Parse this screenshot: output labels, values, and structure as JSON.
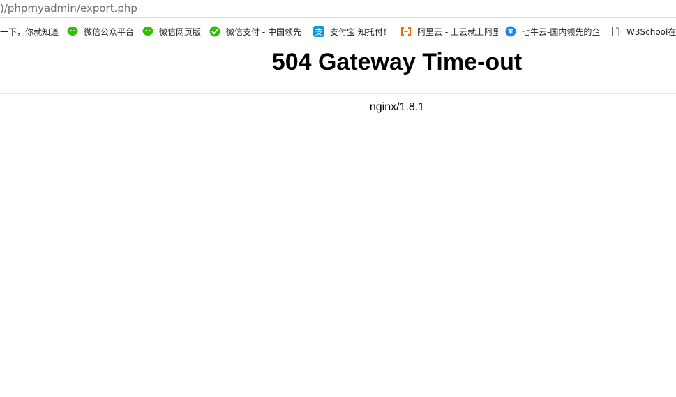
{
  "address_bar": {
    "url": ")/phpmyadmin/export.php"
  },
  "bookmarks": [
    {
      "label": "一下，你就知道",
      "icon": "none"
    },
    {
      "label": "微信公众平台",
      "icon": "wechat-icon"
    },
    {
      "label": "微信网页版",
      "icon": "wechat-icon"
    },
    {
      "label": "微信支付 - 中国领先",
      "icon": "wechat-pay-icon"
    },
    {
      "label": "支付宝 知托付！",
      "icon": "alipay-icon"
    },
    {
      "label": "阿里云 - 上云就上阿里",
      "icon": "aliyun-icon"
    },
    {
      "label": "七牛云-国内领先的企",
      "icon": "qiniu-icon"
    },
    {
      "label": "W3School在",
      "icon": "page-icon"
    }
  ],
  "colors": {
    "wechat": "#2dc100",
    "alipay": "#1296db",
    "aliyun": "#ff6a00",
    "qiniu": "#1e88e5"
  },
  "error_page": {
    "title": "504 Gateway Time-out",
    "server": "nginx/1.8.1"
  }
}
